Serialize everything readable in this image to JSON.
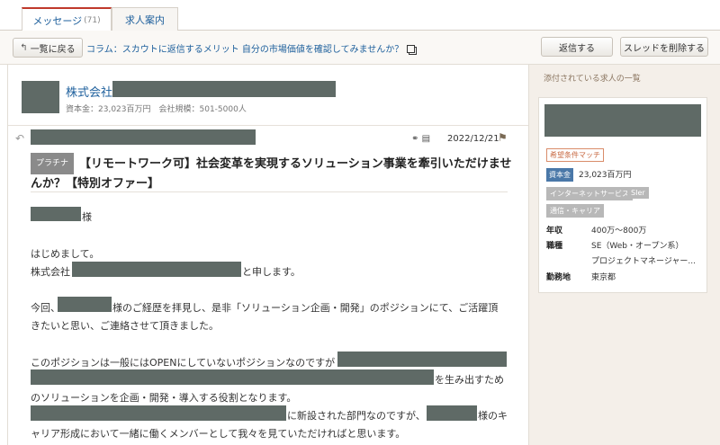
{
  "tabs": [
    {
      "label": "メッセージ",
      "count": "(71)"
    },
    {
      "label": "求人案内"
    }
  ],
  "toolbar": {
    "back_label": "一覧に戻る",
    "column_link": "コラム：スカウトに返信するメリット 自分の市場価値を確認してみませんか？",
    "reply_label": "返信する",
    "delete_label": "スレッドを削除する"
  },
  "company": {
    "name_prefix": "株式会社",
    "meta": "資本金：23,023百万円　会社規模：501-5000人"
  },
  "message": {
    "date": "2022/12/21",
    "badge": "プラチナ",
    "subject": "【リモートワーク可】社会変革を実現するソリューション事業を牽引いただけませんか？【特別オファー】",
    "lines": {
      "salutation": "様",
      "greeting": "はじめまして。",
      "intro_prefix": "株式会社",
      "intro_suffix": "と申します。",
      "p2_prefix": "今回、",
      "p2_suffix": "様のご経歴を拝見し、是非「ソリューション企画・開発」のポジションにて、ご活躍頂",
      "p2_line2": "きたいと思い、ご連絡させて頂きました。",
      "p3_line1": "このポジションは一般にはOPENにしていないポジションなのですが",
      "p3_line2_suffix": "を生み出すため",
      "p3_line3": "のソリューションを企画・開発・導入する役割となります。",
      "p3_line4_mid": "に新設された部門なのですが、",
      "p3_line4_suffix": "様のキ",
      "p3_line5": "ャリア形成において一緒に働くメンバーとして我々を見ていただければと思います。"
    }
  },
  "sidebar": {
    "heading": "添付されている求人の一覧",
    "tag_match": "希望条件マッチ",
    "capital_tag": "資本金",
    "capital_value": "23,023百万円",
    "industry_tags": [
      "インターネットサービス",
      "SIer",
      "通信・キャリア"
    ],
    "details": [
      {
        "key": "年収",
        "value": "400万〜800万"
      },
      {
        "key": "職種",
        "value": "SE（Web・オープン系）"
      },
      {
        "key": "",
        "value": "プロジェクトマネージャー..."
      },
      {
        "key": "勤務地",
        "value": "東京都"
      }
    ]
  }
}
